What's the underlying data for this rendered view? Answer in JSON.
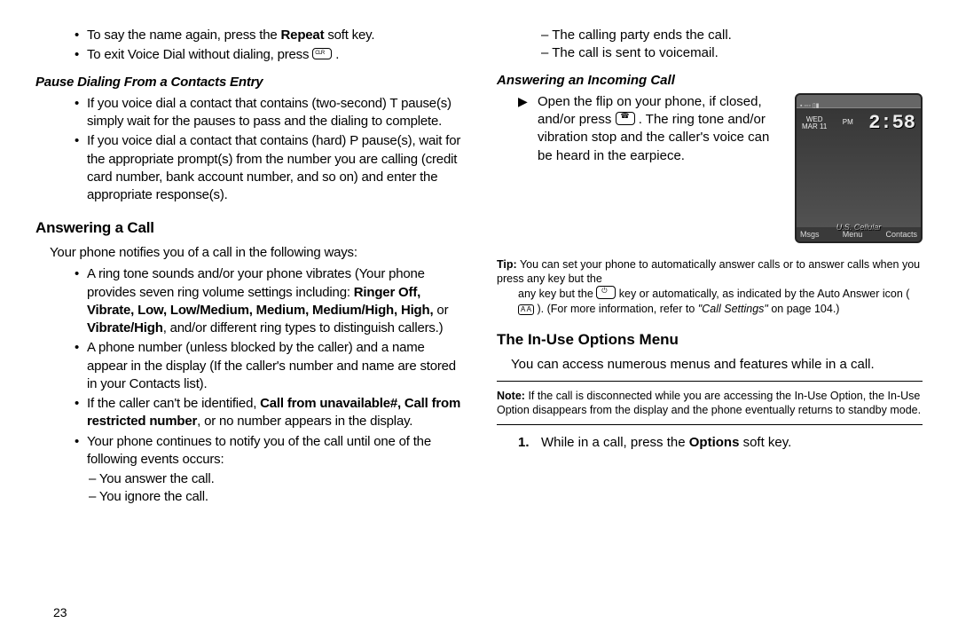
{
  "left": {
    "top_bullets": [
      {
        "pre": "To say the name again, press the ",
        "bold": "Repeat",
        "post": " soft key."
      },
      {
        "pre": "To exit Voice Dial without dialing, press ",
        "glyph": "clr",
        "post": " ."
      }
    ],
    "subhead_pause": "Pause Dialing From a Contacts Entry",
    "pause_bullets": [
      "If you voice dial a contact that contains (two-second) T pause(s) simply wait for the pauses to pass and the dialing to complete.",
      "If you voice dial a contact that contains (hard) P pause(s), wait for the appropriate prompt(s) from the number you are calling (credit card number, bank account number, and so on) and enter the appropriate response(s)."
    ],
    "heading_answer": "Answering a Call",
    "answer_intro": "Your phone notifies you of a call in the following ways:",
    "answer_b1_pre": "A ring tone sounds and/or your phone vibrates (Your phone provides seven ring volume settings including: ",
    "answer_b1_bold": "Ringer Off, Vibrate, Low, Low/Medium, Medium, Medium/High, High,",
    "answer_b1_mid": " or ",
    "answer_b1_bold2": "Vibrate/High",
    "answer_b1_post": ", and/or different ring types to distinguish callers.)",
    "answer_b2": "A phone number (unless blocked by the caller) and a name appear in the display (If the caller's number and name are stored in your Contacts list).",
    "answer_b3_pre": "If the caller can't be identified, ",
    "answer_b3_bold": "Call from unavailable#, Call from restricted number",
    "answer_b3_post": ", or no number appears in the display.",
    "answer_b4": "Your phone continues to notify you of the call until one of the following events occurs:",
    "answer_sub": [
      "– You answer the call.",
      "– You ignore the call."
    ],
    "page_num": "23"
  },
  "right": {
    "top_sub": [
      "– The calling party ends the call.",
      "– The call is sent to voicemail."
    ],
    "subhead_incoming": "Answering an Incoming Call",
    "incoming_pre": "Open the flip on your phone, if closed, and/or press ",
    "incoming_post": " . The ring tone and/or vibration stop and the caller's voice can be heard in the earpiece.",
    "tip_label": "Tip:",
    "tip_line1": "You can set your phone to automatically answer calls or to answer calls when you press any key but the ",
    "tip_mid": " key or automatically, as indicated by the Auto Answer icon ( ",
    "tip_post": " ). (For more information, refer to ",
    "tip_ref": "\"Call Settings\"",
    "tip_end": " on page 104.)",
    "heading_inuse": "The In-Use Options Menu",
    "inuse_intro": "You can access numerous menus and features while in a call.",
    "note_label": "Note:",
    "note_text": "If the call is disconnected while you are accessing the In-Use Option, the In-Use Option disappears from the display and the phone eventually returns to standby mode.",
    "step1_pre": "While in a call, press the ",
    "step1_bold": "Options",
    "step1_post": " soft key.",
    "phone": {
      "day": "WED",
      "date": "MAR 11",
      "pm": "PM",
      "time": "2:58",
      "carrier": "U.S. Cellular",
      "sk_left": "Msgs",
      "sk_mid": "Menu",
      "sk_right": "Contacts"
    }
  }
}
